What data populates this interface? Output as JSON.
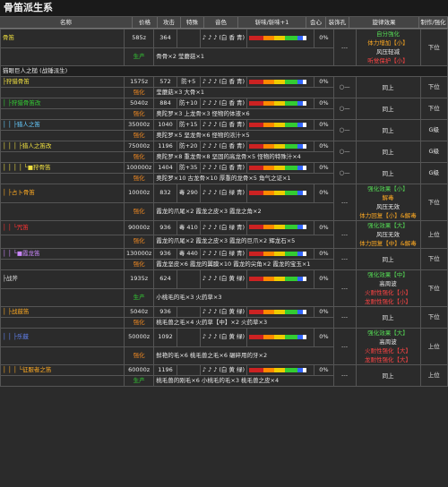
{
  "title": "骨笛派生系",
  "headers": [
    "名称",
    "价格",
    "攻击",
    "特殊",
    "音色",
    "斩味/斩味+1",
    "会心",
    "装饰孔",
    "旋律效果",
    "制作/强化"
  ],
  "rows": [
    {
      "name": "骨笛",
      "price": "585z",
      "atk": "364",
      "special": "",
      "notes": "♪ ♪ ♪ (白 香 青)",
      "aff": "0%",
      "slots": "---",
      "effects": [
        "自分強化",
        "体力增加【小】",
        "风压轻减",
        "听觉保护【小】"
      ],
      "make": "下位",
      "mat_tag": "生产",
      "mats": "骨骨×2 莹蘑菇×1"
    },
    {
      "name": "猫眼巨人之槌 (战锤派生)",
      "section": true
    },
    {
      "name": "├狩猎骨笛",
      "price": "1575z",
      "atk": "572",
      "special": "防+5",
      "notes": "♪ ♪ ♪ (白 香 青)",
      "aff": "0%",
      "slots": "○—",
      "effects": [
        "同上"
      ],
      "make": "下位",
      "mat_tag": "强化",
      "mats": "莹蘑菇×3 大骨×1"
    },
    {
      "name": "│ ├狩猎骨笛改",
      "price": "5040z",
      "atk": "884",
      "special": "防+10",
      "notes": "♪ ♪ ♪ (白 香 青)",
      "aff": "0%",
      "slots": "○—",
      "effects": [
        "同上"
      ],
      "make": "下位",
      "mat_tag": "强化",
      "mats": "奥陀罗×3 上龙骨×3 怪物的体液×6"
    },
    {
      "name": "│ │ ├猎人之笛",
      "price": "35000z",
      "atk": "1040",
      "special": "防+15",
      "notes": "♪ ♪ ♪ (白 香 青)",
      "aff": "0%",
      "slots": "○—",
      "effects": [
        "同上"
      ],
      "make": "G级",
      "mat_tag": "强化",
      "mats": "奥陀罗×5 坚龙骨×6 怪物的浓汁×5"
    },
    {
      "name": "│ │ │ ├猎人之笛改",
      "price": "75000z",
      "atk": "1196",
      "special": "防+20",
      "notes": "♪ ♪ ♪ (白 香 青)",
      "aff": "0%",
      "slots": "○—",
      "effects": [
        "同上"
      ],
      "make": "G级",
      "mat_tag": "强化",
      "mats": "奥陀罗×8 重龙骨×8 坚固的高龙骨×5 怪物的特殊汁×4"
    },
    {
      "name": "│ │ │ │ └■狩骨笛",
      "price": "100000z",
      "atk": "1404",
      "special": "防+35",
      "notes": "♪ ♪ ♪ (白 香 青)",
      "aff": "0%",
      "slots": "○—",
      "effects": [
        "同上"
      ],
      "make": "G级",
      "mat_tag": "强化",
      "mats": "奥陀罗×10 古龙骨×10 厚重的龙骨×5 角气之证×1"
    },
    {
      "name": "│ ├占卜骨笛",
      "price": "10000z",
      "atk": "832",
      "special": "毒 290",
      "notes": "♪ ♪ ♪ (白 绿 青)",
      "aff": "0%",
      "slots": "---",
      "effects": [
        "强化效果【小】",
        "解毒",
        "风压无效",
        "体力回复【小】&解毒"
      ],
      "make": "下位",
      "mat_tag": "强化",
      "mats": "霞龙的爪尾×2 霞龙之皮×3 霞龙之角×2"
    },
    {
      "name": "│ │ └咒笛",
      "price": "90000z",
      "atk": "936",
      "special": "毒 410",
      "notes": "♪ ♪ ♪ (白 绿 青)",
      "aff": "0%",
      "slots": "---",
      "effects": [
        "强化效果【大】",
        "风压无效",
        "体力回复【中】&解毒"
      ],
      "make": "上位",
      "mat_tag": "强化",
      "mats": "霞龙的爪尾×2 霞龙之皮×3 霞龙的巨爪×2 辉龙石×5"
    },
    {
      "name": "│ │ └■霞龙笛",
      "price": "130000z",
      "atk": "936",
      "special": "毒 440",
      "notes": "♪ ♪ ♪ (白 绿 青)",
      "aff": "0%",
      "slots": "---",
      "effects": [
        "同上"
      ],
      "make": "下位",
      "mat_tag": "强化",
      "mats": "霞龙坚皮×6 霞龙的翼膜×10 霞龙的尖角×2 霞龙的宝玉×1"
    },
    {
      "name": "├战斧",
      "price": "1935z",
      "atk": "624",
      "special": "",
      "notes": "♪ ♪ ♪ (白 黄 绿)",
      "aff": "0%",
      "slots": "---",
      "effects": [
        "强化效果【中】",
        "高周波",
        "火耐性强化【小】",
        "龙耐性强化【小】"
      ],
      "make": "下位",
      "mat_tag": "生产",
      "mats": "小桃毛的毛×3 火药草×3"
    },
    {
      "name": "│ ├战鼓笛",
      "price": "5040z",
      "atk": "936",
      "special": "",
      "notes": "♪ ♪ ♪ (白 黄 绿)",
      "aff": "0%",
      "slots": "---",
      "effects": [
        "同上"
      ],
      "make": "下位",
      "mat_tag": "强化",
      "mats": "桃毛兽之毛×4 火药草【中】×2 火药草×3"
    },
    {
      "name": "│ │ ├乐鼓",
      "price": "50000z",
      "atk": "1092",
      "special": "",
      "notes": "♪ ♪ ♪ (白 黄 绿)",
      "aff": "0%",
      "slots": "---",
      "effects": [
        "强化效果【大】",
        "高周波",
        "火耐性强化【大】",
        "龙耐性强化【大】"
      ],
      "make": "上位",
      "mat_tag": "强化",
      "mats": "鲜艳的毛×6 桃毛兽之毛×6 碾碎用的牙×2"
    },
    {
      "name": "│ │ │ └征服者之笛",
      "price": "60000z",
      "atk": "1196",
      "special": "",
      "notes": "♪ ♪ ♪ (白 黄 绿)",
      "aff": "0%",
      "slots": "---",
      "effects": [
        "同上"
      ],
      "make": "上位",
      "mat_tag": "生产",
      "mats": "桃毛兽的刚毛×6 小桃毛的毛×3 桃毛兽之皮×4"
    }
  ]
}
